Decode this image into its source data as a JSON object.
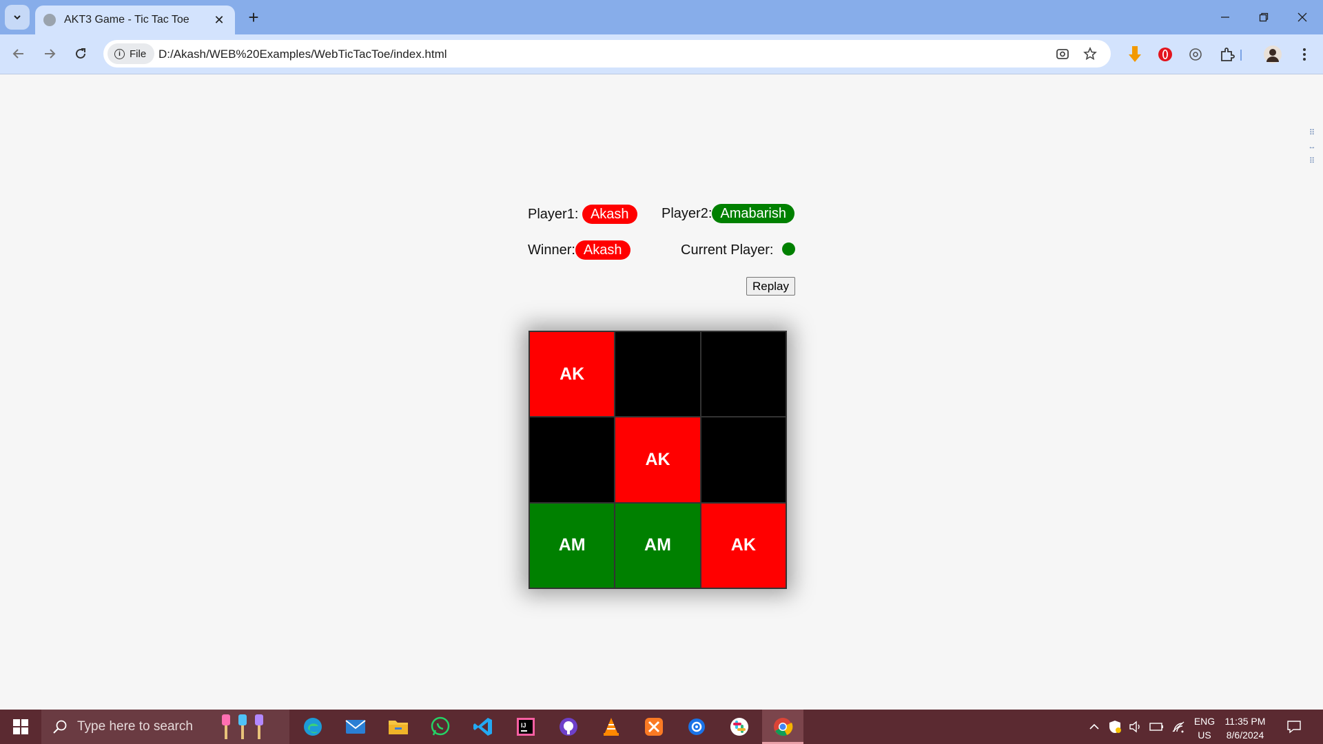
{
  "browser": {
    "tab_title": "AKT3 Game - Tic Tac Toe",
    "tab_close": "✕",
    "new_tab": "+",
    "chip_label": "File",
    "url": "D:/Akash/WEB%20Examples/WebTicTacToe/index.html"
  },
  "game": {
    "player1_label": "Player1:",
    "player1_name": "Akash",
    "player2_label": "Player2:",
    "player2_name": "Amabarish",
    "winner_label": "Winner:",
    "winner_name": "Akash",
    "current_player_label": "Current Player:",
    "current_player_color": "#008000",
    "replay_label": "Replay",
    "colors": {
      "player1": "#ff0000",
      "player2": "#008000",
      "empty": "#000000"
    },
    "board": [
      {
        "text": "AK",
        "owner": "player1"
      },
      {
        "text": "",
        "owner": "empty"
      },
      {
        "text": "",
        "owner": "empty"
      },
      {
        "text": "",
        "owner": "empty"
      },
      {
        "text": "AK",
        "owner": "player1"
      },
      {
        "text": "",
        "owner": "empty"
      },
      {
        "text": "AM",
        "owner": "player2"
      },
      {
        "text": "AM",
        "owner": "player2"
      },
      {
        "text": "AK",
        "owner": "player1"
      }
    ]
  },
  "taskbar": {
    "search_placeholder": "Type here to search",
    "lang_top": "ENG",
    "lang_bottom": "US",
    "time": "11:35 PM",
    "date": "8/6/2024"
  }
}
